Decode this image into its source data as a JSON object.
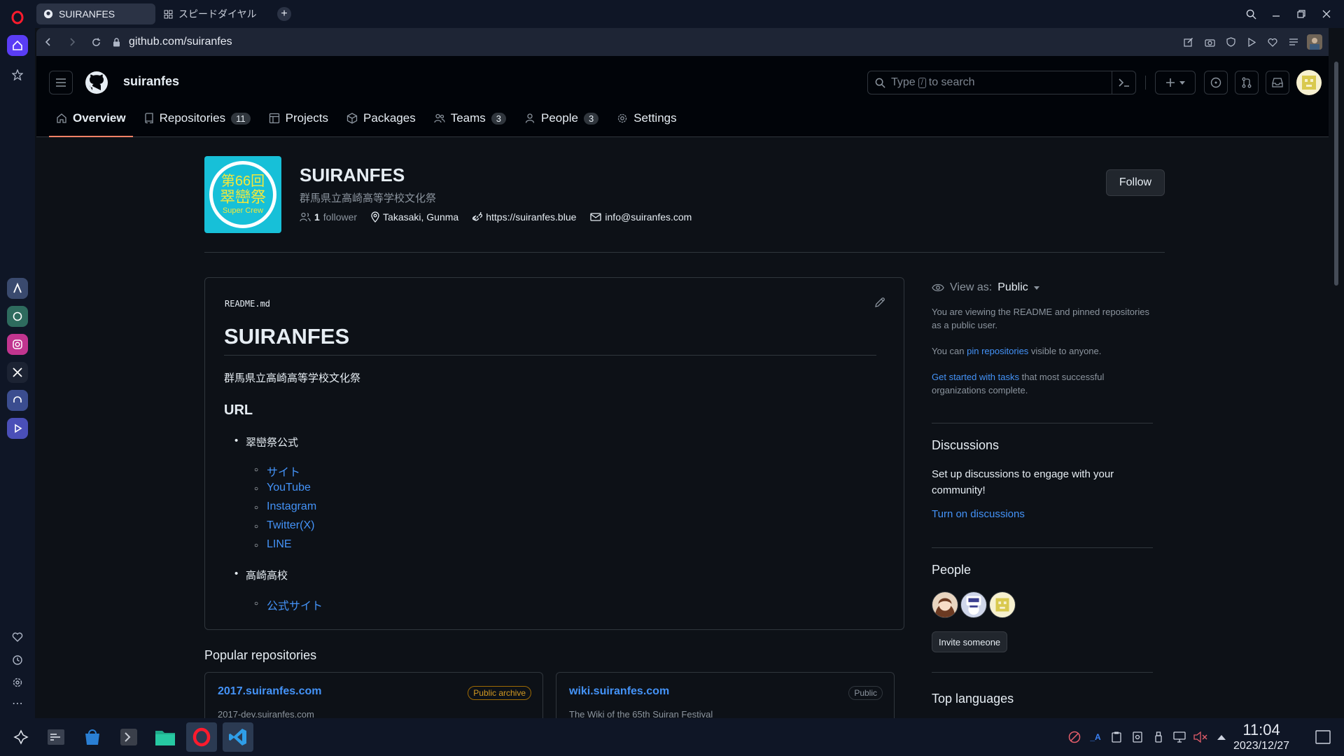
{
  "browser": {
    "tabs": [
      {
        "label": "SUIRANFES",
        "active": true,
        "icon": "github-icon"
      },
      {
        "label": "スピードダイヤル",
        "active": false,
        "icon": "grid-icon"
      }
    ],
    "url": "github.com/suiranfes"
  },
  "github": {
    "org_handle": "suiranfes",
    "search_prefix": "Type",
    "search_key": "/",
    "search_suffix": "to search",
    "nav": [
      {
        "label": "Overview",
        "icon": "home-icon",
        "count": ""
      },
      {
        "label": "Repositories",
        "icon": "repo-icon",
        "count": "11"
      },
      {
        "label": "Projects",
        "icon": "table-icon",
        "count": ""
      },
      {
        "label": "Packages",
        "icon": "package-icon",
        "count": ""
      },
      {
        "label": "Teams",
        "icon": "people-icon",
        "count": "3"
      },
      {
        "label": "People",
        "icon": "person-icon",
        "count": "3"
      },
      {
        "label": "Settings",
        "icon": "gear-icon",
        "count": ""
      }
    ]
  },
  "org": {
    "logo_line1": "第66回",
    "logo_line2": "翠巒祭",
    "logo_line3": "Super Crew",
    "name": "SUIRANFES",
    "description": "群馬県立高崎高等学校文化祭",
    "followers_count": "1",
    "followers_label": "follower",
    "location": "Takasaki, Gunma",
    "website": "https://suiranfes.blue",
    "email": "info@suiranfes.com",
    "follow_label": "Follow"
  },
  "readme": {
    "filename": "README.md",
    "heading": "SUIRANFES",
    "paragraph": "群馬県立高崎高等学校文化祭",
    "section": "URL",
    "group1": "翠巒祭公式",
    "group1_links": [
      "サイト",
      "YouTube",
      "Instagram",
      "Twitter(X)",
      "LINE"
    ],
    "group2": "高崎高校",
    "group2_links": [
      "公式サイト"
    ]
  },
  "popular": {
    "title": "Popular repositories",
    "repos": [
      {
        "name": "2017.suiranfes.com",
        "badge": "Public archive",
        "desc": "2017-dev.suiranfes.com"
      },
      {
        "name": "wiki.suiranfes.com",
        "badge": "Public",
        "desc": "The Wiki of the 65th Suiran Festival"
      }
    ]
  },
  "sidebar": {
    "view_as_label": "View as:",
    "view_as_value": "Public",
    "viewing_text": "You are viewing the README and pinned repositories as a public user.",
    "pin_prefix": "You can",
    "pin_link": "pin repositories",
    "pin_suffix": "visible to anyone.",
    "tasks_link": "Get started with tasks",
    "tasks_suffix": "that most successful organizations complete.",
    "discussions_title": "Discussions",
    "discussions_text": "Set up discussions to engage with your community!",
    "discussions_link": "Turn on discussions",
    "people_title": "People",
    "invite_label": "Invite someone",
    "top_languages_title": "Top languages"
  },
  "taskbar": {
    "time": "11:04",
    "date": "2023/12/27"
  },
  "colors": {
    "accent_underline": "#f78166",
    "link": "#4493f8",
    "archive_badge": "#d29922",
    "logo_bg": "#17c0d8",
    "logo_text": "#f5e838"
  }
}
